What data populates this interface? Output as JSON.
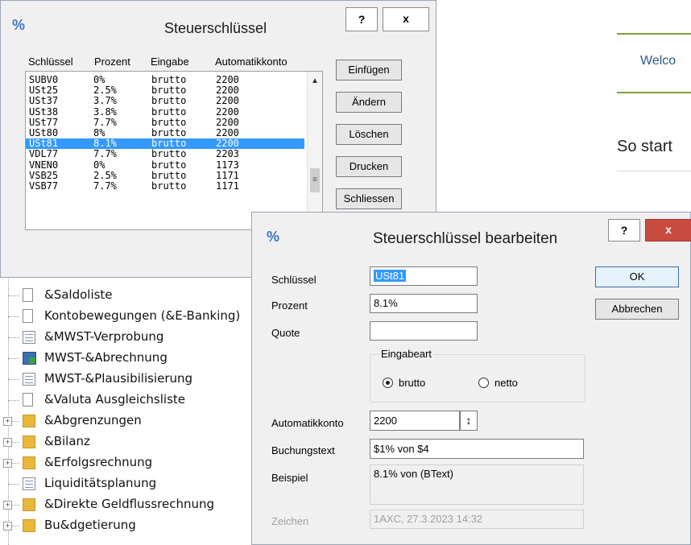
{
  "background_page": {
    "welcome_text": "Welco",
    "so_start_text": "So start",
    "accent_color": "#7aa23a"
  },
  "tree": {
    "items": [
      {
        "label": "&Saldoliste",
        "icon": "document-icon",
        "expander": false
      },
      {
        "label": "Kontobewegungen (&E-Banking)",
        "icon": "document-icon",
        "expander": false
      },
      {
        "label": "&MWST-Verprobung",
        "icon": "report-icon",
        "expander": false
      },
      {
        "label": "MWST-&Abrechnung",
        "icon": "run-report-icon",
        "expander": false
      },
      {
        "label": "MWST-&Plausibilisierung",
        "icon": "report-icon",
        "expander": false
      },
      {
        "label": "&Valuta Ausgleichsliste",
        "icon": "document-icon",
        "expander": false
      },
      {
        "label": "&Abgrenzungen",
        "icon": "folder-icon",
        "expander": true
      },
      {
        "label": "&Bilanz",
        "icon": "folder-icon",
        "expander": true
      },
      {
        "label": "&Erfolgsrechnung",
        "icon": "folder-icon",
        "expander": true
      },
      {
        "label": "Liquiditätsplanung",
        "icon": "report-icon",
        "expander": false
      },
      {
        "label": "&Direkte Geldflussrechnung",
        "icon": "folder-icon",
        "expander": true
      },
      {
        "label": "Bu&dgetierung",
        "icon": "folder-icon",
        "expander": true
      }
    ]
  },
  "dialog_list": {
    "title": "Steuerschlüssel",
    "help_label": "?",
    "close_label": "x",
    "columns": [
      "Schlüssel",
      "Prozent",
      "Eingabe",
      "Automatikkonto"
    ],
    "rows": [
      [
        "SUBV0",
        "0%",
        "brutto",
        "2200"
      ],
      [
        "USt25",
        "2.5%",
        "brutto",
        "2200"
      ],
      [
        "USt37",
        "3.7%",
        "brutto",
        "2200"
      ],
      [
        "USt38",
        "3.8%",
        "brutto",
        "2200"
      ],
      [
        "USt77",
        "7.7%",
        "brutto",
        "2200"
      ],
      [
        "USt80",
        "8%",
        "brutto",
        "2200"
      ],
      [
        "USt81",
        "8.1%",
        "brutto",
        "2200"
      ],
      [
        "VDL77",
        "7.7%",
        "brutto",
        "2203"
      ],
      [
        "VNEN0",
        "0%",
        "brutto",
        "1173"
      ],
      [
        "VSB25",
        "2.5%",
        "brutto",
        "1171"
      ],
      [
        "VSB77",
        "7.7%",
        "brutto",
        "1171"
      ]
    ],
    "selected_row": 6,
    "buttons": {
      "insert": "Einfügen",
      "edit": "Ändern",
      "delete": "Löschen",
      "print": "Drucken",
      "close": "Schliessen"
    },
    "selection_color": "#3399ff"
  },
  "dialog_edit": {
    "title": "Steuerschlüssel bearbeiten",
    "help_label": "?",
    "close_label": "x",
    "close_color": "#c94a3f",
    "labels": {
      "key": "Schlüssel",
      "percent": "Prozent",
      "quota": "Quote",
      "input_type": "Eingabeart",
      "auto_account": "Automatikkonto",
      "booking_text": "Buchungstext",
      "example": "Beispiel",
      "signature": "Zeichen"
    },
    "values": {
      "key": "USt81",
      "percent": "8.1%",
      "quota": "",
      "auto_account": "2200",
      "booking_text": "$1% von $4",
      "example": "8.1% von (BText)",
      "signature": "1AXC, 27.3.2023 14:32"
    },
    "radio": {
      "gross": "brutto",
      "net": "netto",
      "selected": "brutto"
    },
    "buttons": {
      "ok": "OK",
      "cancel": "Abbrechen"
    }
  }
}
